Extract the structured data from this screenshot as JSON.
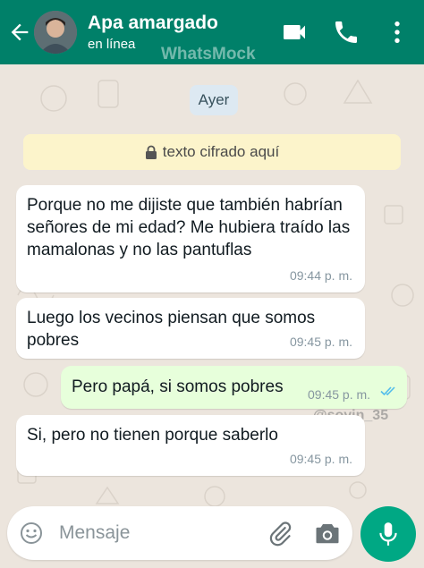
{
  "header": {
    "contact_name": "Apa amargado",
    "status": "en línea",
    "watermark": "WhatsMock"
  },
  "date_chip": "Ayer",
  "encryption_banner": "texto cifrado aquí",
  "messages": [
    {
      "direction": "incoming",
      "text": "Porque no me dijiste que también habrían señores de mi edad? Me hubiera traído las mamalonas y no las pantuflas",
      "time": "09:44 p. m."
    },
    {
      "direction": "incoming",
      "text": "Luego los vecinos piensan que somos pobres",
      "time": "09:45 p. m."
    },
    {
      "direction": "outgoing",
      "text": "Pero papá, si somos pobres",
      "time": "09:45 p. m.",
      "status": "read"
    },
    {
      "direction": "incoming",
      "text": "Si, pero no tienen porque saberlo",
      "time": "09:45 p. m."
    }
  ],
  "overlay_watermark": "@soyin_35",
  "composer": {
    "placeholder": "Mensaje"
  },
  "icons": {
    "back": "arrow-left-icon",
    "video": "video-call-icon",
    "call": "phone-icon",
    "menu": "more-vertical-icon",
    "lock": "lock-icon",
    "emoji": "emoji-icon",
    "attach": "paperclip-icon",
    "camera": "camera-icon",
    "mic": "mic-icon"
  },
  "colors": {
    "header": "#008069",
    "outgoing_bubble": "#e7ffdb",
    "read_ticks": "#53bdeb",
    "mic_button": "#00a884"
  }
}
